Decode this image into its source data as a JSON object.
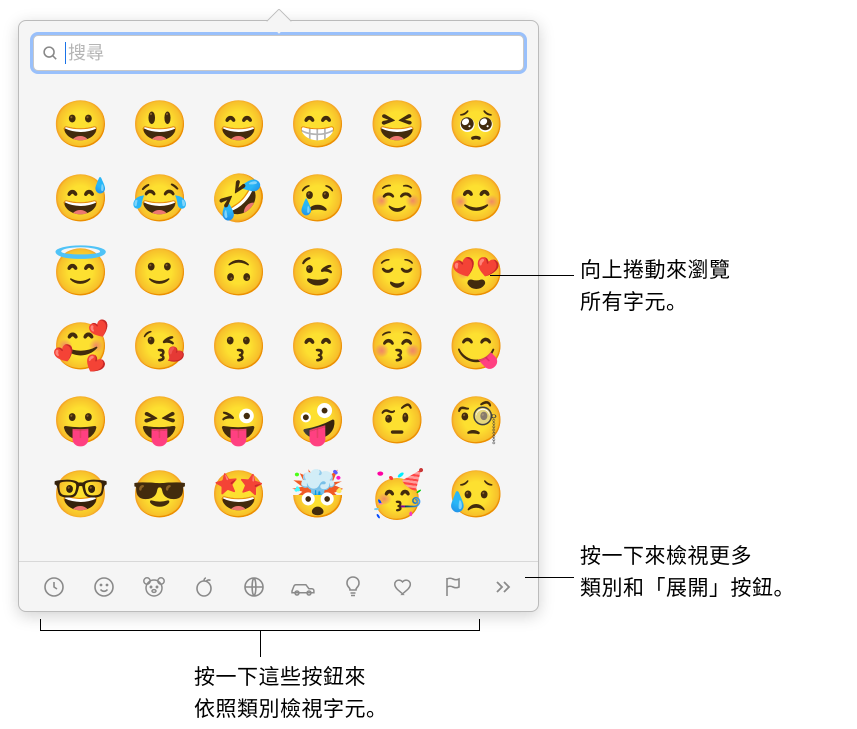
{
  "search": {
    "placeholder": "搜尋",
    "value": ""
  },
  "emoji_rows": [
    [
      "😀",
      "😃",
      "😄",
      "😁",
      "😆",
      "🥺"
    ],
    [
      "😅",
      "😂",
      "🤣",
      "😢",
      "☺️",
      "😊"
    ],
    [
      "😇",
      "🙂",
      "🙃",
      "😉",
      "😌",
      "😍"
    ],
    [
      "🥰",
      "😘",
      "😗",
      "😙",
      "😚",
      "😋"
    ],
    [
      "😛",
      "😝",
      "😜",
      "🤪",
      "🤨",
      "🧐"
    ],
    [
      "🤓",
      "😎",
      "🤩",
      "🤯",
      "🥳",
      "😥"
    ]
  ],
  "categories": [
    {
      "name": "recent-icon",
      "label": "最近使用"
    },
    {
      "name": "smiley-icon",
      "label": "表情符號"
    },
    {
      "name": "animals-icon",
      "label": "動物與自然"
    },
    {
      "name": "food-icon",
      "label": "食物與飲品"
    },
    {
      "name": "activity-icon",
      "label": "活動"
    },
    {
      "name": "travel-icon",
      "label": "旅行與地點"
    },
    {
      "name": "objects-icon",
      "label": "物件"
    },
    {
      "name": "symbols-icon",
      "label": "符號"
    },
    {
      "name": "flags-icon",
      "label": "旗子"
    },
    {
      "name": "more-icon",
      "label": "更多"
    }
  ],
  "annotations": {
    "scroll_up_line1": "向上捲動來瀏覽",
    "scroll_up_line2": "所有字元。",
    "more_line1": "按一下來檢視更多",
    "more_line2": "類別和「展開」按鈕。",
    "category_line1": "按一下這些按鈕來",
    "category_line2": "依照類別檢視字元。"
  }
}
